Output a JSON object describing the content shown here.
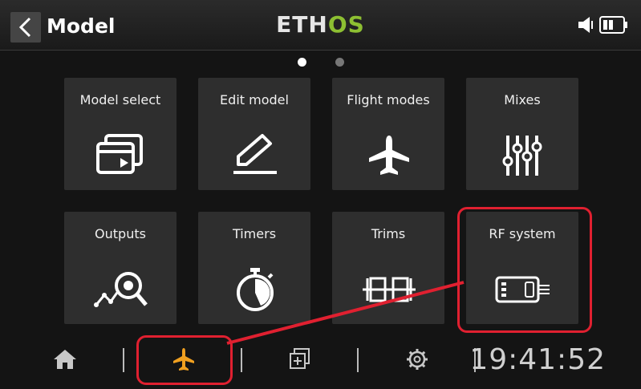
{
  "header": {
    "title": "Model",
    "logo_part1": "ETH",
    "logo_part2": "OS",
    "back_icon": "chevron-left-icon",
    "status_icons": [
      "speaker-icon",
      "battery-icon"
    ]
  },
  "pager": {
    "pages": 2,
    "current": 1
  },
  "tiles": [
    {
      "label": "Model select",
      "icon": "model-select-icon"
    },
    {
      "label": "Edit model",
      "icon": "pencil-icon"
    },
    {
      "label": "Flight modes",
      "icon": "airplane-icon"
    },
    {
      "label": "Mixes",
      "icon": "sliders-icon"
    },
    {
      "label": "Outputs",
      "icon": "outputs-icon"
    },
    {
      "label": "Timers",
      "icon": "stopwatch-icon"
    },
    {
      "label": "Trims",
      "icon": "trims-icon"
    },
    {
      "label": "RF system",
      "icon": "rf-module-icon"
    }
  ],
  "bottombar": {
    "icons": [
      "home-icon",
      "airplane-icon",
      "screens-icon",
      "gear-icon"
    ],
    "active": "airplane-icon",
    "clock": "19:41:52"
  },
  "colors": {
    "accent_active": "#f0a020",
    "logo_green": "#8dbf32",
    "annotation": "#e02030"
  }
}
